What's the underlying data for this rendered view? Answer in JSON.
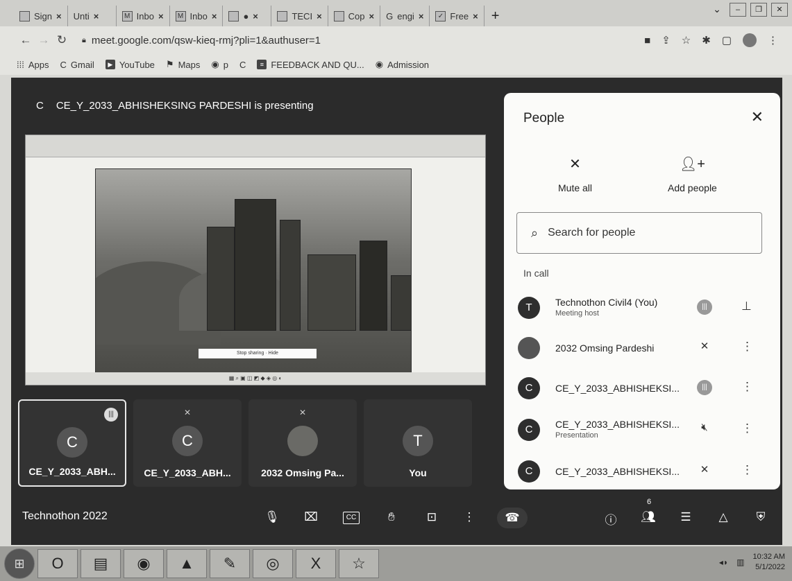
{
  "browser": {
    "tabs": [
      {
        "label": "Sign",
        "icon": "sheet-icon"
      },
      {
        "label": "Unti",
        "icon": "doc-icon"
      },
      {
        "label": "Inbo",
        "icon": "gmail-icon"
      },
      {
        "label": "Inbo",
        "icon": "gmail-icon"
      },
      {
        "label": "",
        "icon": "meet-icon"
      },
      {
        "label": "TECI",
        "icon": "form-icon"
      },
      {
        "label": "Cop",
        "icon": "classroom-icon"
      },
      {
        "label": "engi",
        "icon": "google-icon"
      },
      {
        "label": "Free",
        "icon": "check-icon"
      }
    ],
    "url": "meet.google.com/qsw-kieq-rmj?pli=1&authuser=1",
    "bookmarks": [
      "Apps",
      "Gmail",
      "YouTube",
      "Maps",
      "p",
      "",
      "FEEDBACK AND QU...",
      "Admission"
    ]
  },
  "meet": {
    "presenting_text": "CE_Y_2033_ABHISHEKSING PARDESHI is presenting",
    "presenting_initial": "C",
    "tiles": [
      {
        "initial": "C",
        "name": "CE_Y_2033_ABH...",
        "active": true
      },
      {
        "initial": "C",
        "name": "CE_Y_2033_ABH..."
      },
      {
        "initial": "",
        "name": "2032 Omsing Pa..."
      },
      {
        "initial": "T",
        "name": "You"
      }
    ],
    "meeting_name": "Technothon 2022",
    "participant_count": "6",
    "shared_screen": {
      "caption_bar": "Stop sharing  ·  Hide"
    }
  },
  "people_panel": {
    "title": "People",
    "mute_all": "Mute all",
    "add_people": "Add people",
    "search_placeholder": "Search for people",
    "in_call": "In call",
    "participants": [
      {
        "initial": "T",
        "name": "Technothon Civil4 (You)",
        "sub": "Meeting host",
        "mic": "speaking",
        "action": "pin"
      },
      {
        "initial": "",
        "name": "2032 Omsing Pardeshi",
        "sub": "",
        "mic": "muted",
        "action": "more"
      },
      {
        "initial": "C",
        "name": "CE_Y_2033_ABHISHEKSI...",
        "sub": "",
        "mic": "speaking",
        "action": "more"
      },
      {
        "initial": "C",
        "name": "CE_Y_2033_ABHISHEKSI...",
        "sub": "Presentation",
        "mic": "muted-audio",
        "action": "more"
      },
      {
        "initial": "C",
        "name": "CE_Y_2033_ABHISHEKSI...",
        "sub": "",
        "mic": "muted",
        "action": "more"
      }
    ]
  },
  "taskbar": {
    "time": "10:32 AM",
    "date": "5/1/2022"
  }
}
